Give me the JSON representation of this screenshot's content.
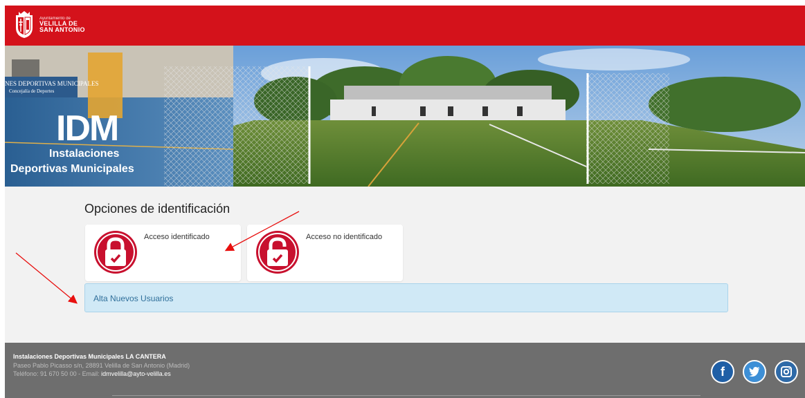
{
  "header": {
    "logo": {
      "small": "Ayuntamiento de",
      "line1": "VELILLA DE",
      "line2": "SAN ANTONIO"
    }
  },
  "banner": {
    "sign_line1": "NES DEPORTIVAS MUNICIPALES",
    "sign_line2": "Concejalía de Deportes",
    "idm": "IDM",
    "sub1": "Instalaciones",
    "sub2": "Deportivas Municipales"
  },
  "main": {
    "title": "Opciones de identificación",
    "options": [
      {
        "label": "Acceso identificado",
        "icon": "lock-closed-icon"
      },
      {
        "label": "Acceso no identificado",
        "icon": "lock-open-icon"
      }
    ],
    "register_label": "Alta Nuevos Usuarios"
  },
  "footer": {
    "title": "Instalaciones Deportivas Municipales LA CANTERA",
    "address": "Paseo Pablo Picasso s/n, 28891 Velilla de San Antonio (Madrid)",
    "phone_prefix": "Teléfono: 91 670 50 00 - Email: ",
    "email": "idmvelilla@ayto-velilla.es",
    "social": [
      {
        "name": "facebook",
        "glyph": "f"
      },
      {
        "name": "twitter",
        "glyph": "🐦"
      },
      {
        "name": "instagram",
        "glyph": "◙"
      }
    ]
  },
  "colors": {
    "header_red": "#d4121b",
    "lock_red": "#c8102e",
    "footer_gray": "#6e6e6e",
    "alert_blue": "#d0e9f6"
  }
}
